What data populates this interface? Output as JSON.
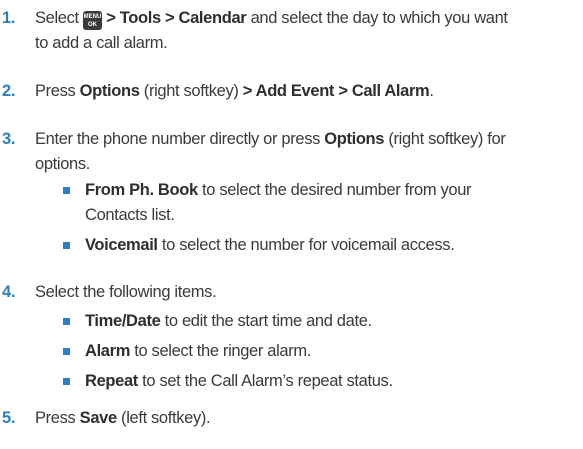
{
  "steps": [
    {
      "num": "1.",
      "select": "Select",
      "menu_icon": {
        "top": "MENU",
        "bottom": "OK"
      },
      "path": "> Tools > Calendar",
      "rest_1": "and select the day to which you want",
      "rest_2": "to add a call alarm."
    },
    {
      "num": "2.",
      "pre": "Press",
      "options": "Options",
      "mid": "(right softkey)",
      "path": "> Add Event > Call Alarm",
      "end": "."
    },
    {
      "num": "3.",
      "pre": "Enter the phone number directly or press",
      "options": "Options",
      "mid": "(right softkey) for",
      "line2": "options.",
      "bullets": [
        {
          "bold": "From Ph. Book",
          "text_1": "to select the desired number from your",
          "text_2": "Contacts list."
        },
        {
          "bold": "Voicemail",
          "text_1": "to select the number for voicemail access."
        }
      ]
    },
    {
      "num": "4.",
      "text": "Select the following items.",
      "bullets": [
        {
          "bold": "Time/Date",
          "text_1": "to edit the start time and date."
        },
        {
          "bold": "Alarm",
          "text_1": "to select the ringer alarm."
        },
        {
          "bold": "Repeat",
          "text_1": "to set the Call Alarm’s repeat status."
        }
      ]
    },
    {
      "num": "5.",
      "pre": "Press",
      "save": "Save",
      "end": "(left softkey)."
    }
  ]
}
